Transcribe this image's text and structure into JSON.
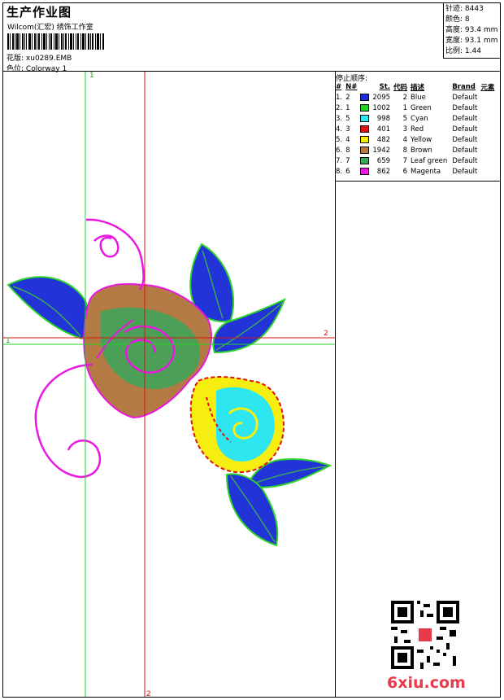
{
  "header": {
    "title": "生产作业图",
    "company": "Wilcom(汇宏) 绣饰工作室",
    "design_label": "花版:",
    "design_file": "xu0289.EMB",
    "colorway_label": "色位:",
    "colorway": "Colorway 1"
  },
  "stats": [
    {
      "label": "针迹:",
      "value": "8443"
    },
    {
      "label": "颜色:",
      "value": "8"
    },
    {
      "label": "高度:",
      "value": "93.4 mm"
    },
    {
      "label": "宽度:",
      "value": "93.1 mm"
    },
    {
      "label": "比例:",
      "value": "1.44"
    }
  ],
  "stop_sequence": {
    "title": "停止顺序:",
    "columns": [
      "#",
      "N#",
      "St.",
      "代码",
      "描述",
      "Brand",
      "元素"
    ],
    "rows": [
      {
        "idx": "1.",
        "n": "2",
        "color": "#1a2bd8",
        "stitches": "2095",
        "code": "2",
        "desc": "Blue",
        "brand": "Default"
      },
      {
        "idx": "2.",
        "n": "1",
        "color": "#22d422",
        "stitches": "1002",
        "code": "1",
        "desc": "Green",
        "brand": "Default"
      },
      {
        "idx": "3.",
        "n": "5",
        "color": "#2ee6f0",
        "stitches": "998",
        "code": "5",
        "desc": "Cyan",
        "brand": "Default"
      },
      {
        "idx": "4.",
        "n": "3",
        "color": "#e01010",
        "stitches": "401",
        "code": "3",
        "desc": "Red",
        "brand": "Default"
      },
      {
        "idx": "5.",
        "n": "4",
        "color": "#f5ee10",
        "stitches": "482",
        "code": "4",
        "desc": "Yellow",
        "brand": "Default"
      },
      {
        "idx": "6.",
        "n": "8",
        "color": "#b47a44",
        "stitches": "1942",
        "code": "8",
        "desc": "Brown",
        "brand": "Default"
      },
      {
        "idx": "7.",
        "n": "7",
        "color": "#3aa65a",
        "stitches": "659",
        "code": "7",
        "desc": "Leaf green",
        "brand": "Default"
      },
      {
        "idx": "8.",
        "n": "6",
        "color": "#e818e0",
        "stitches": "862",
        "code": "6",
        "desc": "Magenta",
        "brand": "Default"
      }
    ]
  },
  "axes": {
    "h_start": "1",
    "h_end": "2",
    "v_start": "1",
    "v_end": "2"
  },
  "watermark": "6xiu.com"
}
